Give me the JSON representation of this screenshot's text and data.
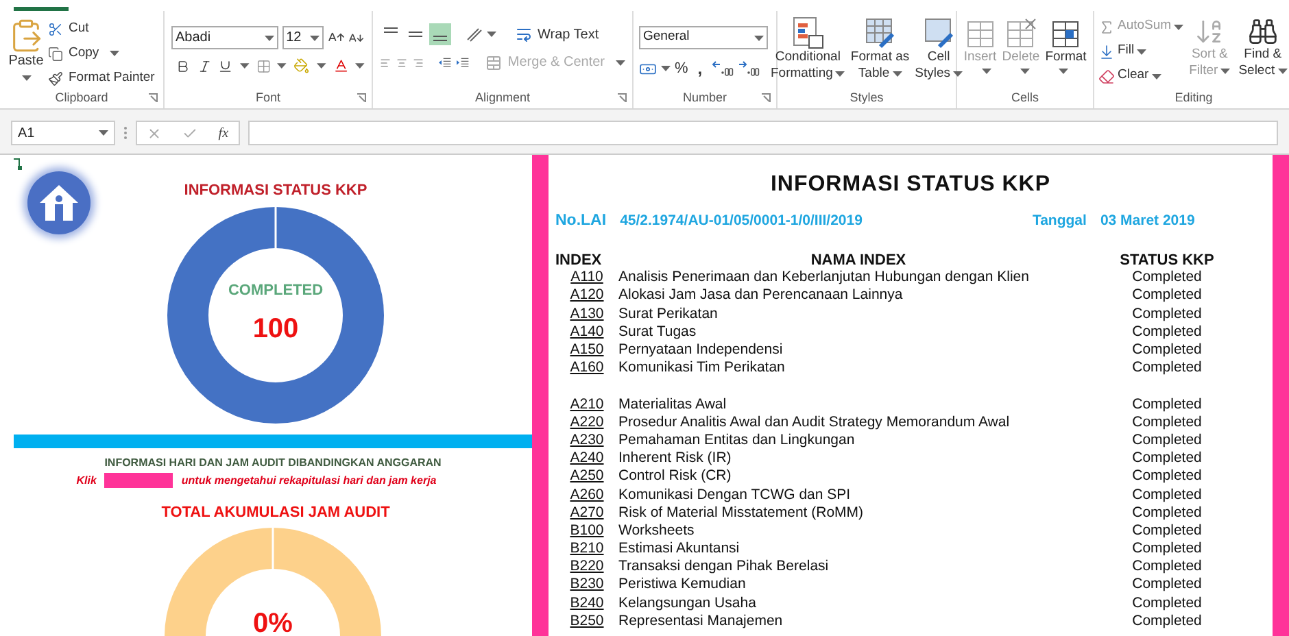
{
  "ribbon": {
    "groups": [
      {
        "kind": "clipboard",
        "label": "Clipboard",
        "paste": "Paste",
        "items": [
          {
            "label": "Cut"
          },
          {
            "label": "Copy"
          },
          {
            "label": "Format Painter"
          }
        ]
      },
      {
        "kind": "font",
        "label": "Font",
        "font_name": "Abadi",
        "font_size": "12"
      },
      {
        "kind": "alignment",
        "label": "Alignment",
        "vertical_align": [
          {
            "selected": false
          },
          {
            "selected": false
          },
          {
            "selected": true
          }
        ],
        "wrap_text": {
          "label": "Wrap Text",
          "disabled": false
        },
        "merge": {
          "label": "Merge & Center",
          "disabled": true
        }
      },
      {
        "kind": "number",
        "label": "Number",
        "format": "General",
        "percent": "%",
        "comma": ","
      },
      {
        "kind": "styles",
        "label": "Styles",
        "buttons": [
          {
            "lines": [
              "Conditional",
              "Formatting"
            ]
          },
          {
            "lines": [
              "Format as",
              "Table"
            ]
          },
          {
            "lines": [
              "Cell",
              "Styles"
            ]
          }
        ]
      },
      {
        "kind": "cells",
        "label": "Cells",
        "buttons": [
          {
            "label": "Insert",
            "disabled": true
          },
          {
            "label": "Delete",
            "disabled": true
          },
          {
            "label": "Format",
            "disabled": false
          }
        ]
      },
      {
        "kind": "editing",
        "label": "Editing",
        "small": [
          {
            "label": "AutoSum",
            "disabled": true
          },
          {
            "label": "Fill",
            "disabled": false
          },
          {
            "label": "Clear",
            "disabled": false
          }
        ],
        "large": [
          {
            "lines": [
              "Sort &",
              "Filter"
            ],
            "disabled": true
          },
          {
            "lines": [
              "Find &",
              "Select"
            ],
            "disabled": false
          }
        ]
      }
    ]
  },
  "formula_bar": {
    "name_box": "A1",
    "function_label": "fx"
  },
  "dashboard": {
    "status_title": "INFORMASI STATUS KKP",
    "status_label": "COMPLETED",
    "status_value": "100",
    "info_title": "INFORMASI HARI DAN JAM AUDIT DIBANDINGKAN ANGGARAN",
    "click_before": "Klik",
    "click_after": "untuk mengetahui rekapitulasi hari dan jam kerja",
    "hours_title": "TOTAL AKUMULASI JAM AUDIT",
    "hours_value": "0%"
  },
  "report": {
    "title": "INFORMASI STATUS KKP",
    "lai_label": "No.LAI",
    "lai_value": "45/2.1974/AU-01/05/0001-1/0/III/2019",
    "date_label": "Tanggal",
    "date_value": "03 Maret 2019",
    "columns": [
      "INDEX",
      "NAMA INDEX",
      "STATUS KKP"
    ],
    "sections": [
      {
        "rows": [
          {
            "index": "A110",
            "name": "Analisis Penerimaan dan Keberlanjutan Hubungan dengan Klien",
            "status": "Completed"
          },
          {
            "index": "A120",
            "name": "Alokasi Jam Jasa dan Perencanaan Lainnya",
            "status": "Completed"
          },
          {
            "index": "A130",
            "name": "Surat Perikatan",
            "status": "Completed"
          },
          {
            "index": "A140",
            "name": "Surat Tugas",
            "status": "Completed"
          },
          {
            "index": "A150",
            "name": "Pernyataan Independensi",
            "status": "Completed"
          },
          {
            "index": "A160",
            "name": "Komunikasi Tim Perikatan",
            "status": "Completed"
          }
        ]
      },
      {
        "rows": [
          {
            "index": "A210",
            "name": "Materialitas Awal",
            "status": "Completed"
          },
          {
            "index": "A220",
            "name": "Prosedur Analitis Awal dan Audit Strategy Memorandum Awal",
            "status": "Completed"
          },
          {
            "index": "A230",
            "name": "Pemahaman Entitas dan Lingkungan",
            "status": "Completed"
          },
          {
            "index": "A240",
            "name": "Inherent Risk (IR)",
            "status": "Completed"
          },
          {
            "index": "A250",
            "name": "Control Risk (CR)",
            "status": "Completed"
          },
          {
            "index": "A260",
            "name": "Komunikasi Dengan TCWG dan SPI",
            "status": "Completed"
          },
          {
            "index": "A270",
            "name": "Risk of Material Misstatement (RoMM)",
            "status": "Completed"
          },
          {
            "index": "B100",
            "name": "Worksheets",
            "status": "Completed"
          },
          {
            "index": "B210",
            "name": "Estimasi Akuntansi",
            "status": "Completed"
          },
          {
            "index": "B220",
            "name": "Transaksi dengan Pihak Berelasi",
            "status": "Completed"
          },
          {
            "index": "B230",
            "name": "Peristiwa Kemudian",
            "status": "Completed"
          },
          {
            "index": "B240",
            "name": "Kelangsungan Usaha",
            "status": "Completed"
          },
          {
            "index": "B250",
            "name": "Representasi Manajemen",
            "status": "Completed"
          }
        ]
      }
    ]
  }
}
